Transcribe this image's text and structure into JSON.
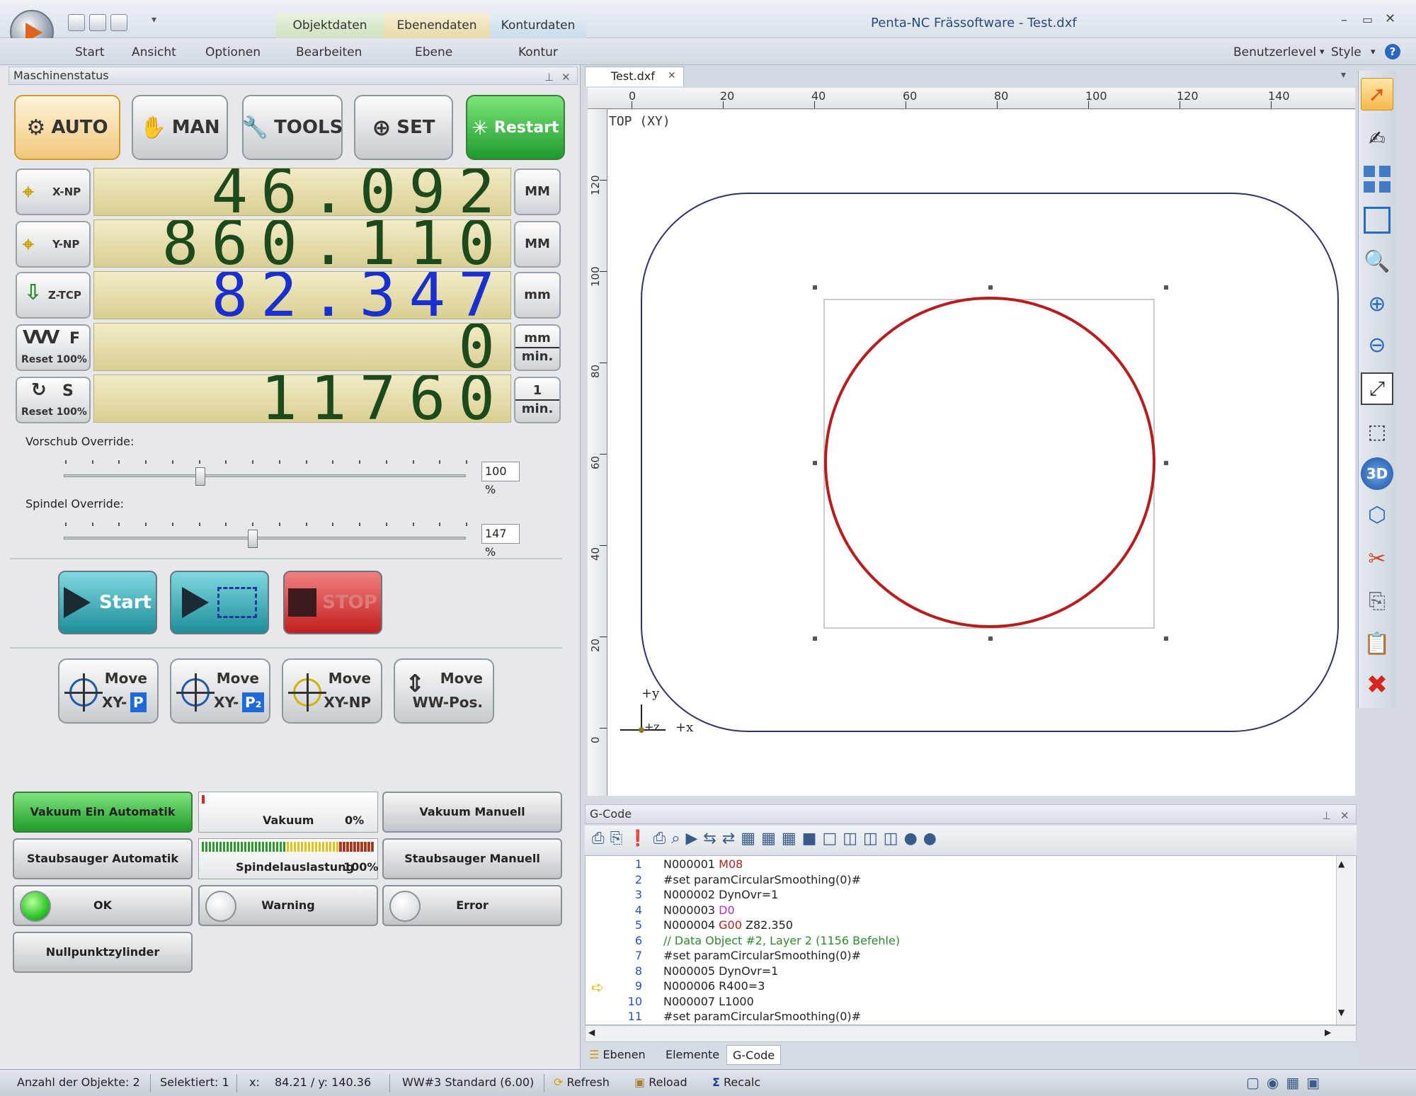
{
  "window": {
    "title": "Penta-NC Frässoftware - Test.dxf"
  },
  "ribbon": {
    "context_headers": [
      "Objektdaten",
      "Ebenendaten",
      "Konturdaten"
    ],
    "tabs": [
      "Start",
      "Ansicht",
      "Optionen",
      "Bearbeiten",
      "Ebene",
      "Kontur"
    ],
    "right": {
      "userlevel": "Benutzerlevel",
      "style": "Style"
    }
  },
  "machine_panel": {
    "title": "Maschinenstatus",
    "modes": {
      "auto": "AUTO",
      "man": "MAN",
      "tools": "TOOLS",
      "set": "SET",
      "restart": "Restart"
    },
    "dro": [
      {
        "label": "X-NP",
        "value": "46.092",
        "unit_top": "MM",
        "unit_bottom": "",
        "color": "#1d4a1d"
      },
      {
        "label": "Y-NP",
        "value": "860.110",
        "unit_top": "MM",
        "unit_bottom": "",
        "color": "#1d4a1d"
      },
      {
        "label": "Z-TCP",
        "value": "82.347",
        "unit_top": "mm",
        "unit_bottom": "",
        "color": "#1a2fd0"
      },
      {
        "label": "F",
        "sub": "Reset 100%",
        "value": "0",
        "unit_top": "mm",
        "unit_bottom": "min.",
        "color": "#1d4a1d"
      },
      {
        "label": "S",
        "sub": "Reset 100%",
        "value": "11760",
        "unit_top": "1",
        "unit_bottom": "min.",
        "color": "#1d4a1d"
      }
    ],
    "feed_override": {
      "label": "Vorschub Override:",
      "value": "100 %",
      "level": 0.34
    },
    "spindle_override": {
      "label": "Spindel Override:",
      "value": "147 %",
      "level": 0.47
    },
    "run": {
      "start": "Start",
      "stop": "STOP"
    },
    "moves": [
      {
        "top": "Move",
        "bottom": "XY-",
        "badge": "P"
      },
      {
        "top": "Move",
        "bottom": "XY-",
        "badge": "P₂"
      },
      {
        "top": "Move",
        "bottom": "XY-NP",
        "badge": ""
      },
      {
        "top": "Move",
        "bottom": "WW-Pos.",
        "badge": ""
      }
    ],
    "status": {
      "vakuum_auto": "Vakuum Ein Automatik",
      "vakuum_label": "Vakuum",
      "vakuum_pct": "0%",
      "vakuum_manuell": "Vakuum Manuell",
      "sauger_auto": "Staubsauger Automatik",
      "spindel_label": "Spindelauslastung",
      "spindel_pct": "100%",
      "sauger_manuell": "Staubsauger Manuell",
      "ok": "OK",
      "warning": "Warning",
      "error": "Error",
      "nullpunkt": "Nullpunktzylinder"
    }
  },
  "document": {
    "tab": "Test.dxf",
    "view_label": "TOP (XY)",
    "ruler_x": [
      "0",
      "20",
      "40",
      "60",
      "80",
      "100",
      "120",
      "140"
    ],
    "ruler_y": [
      "120",
      "100",
      "80",
      "60",
      "40",
      "20",
      "0"
    ],
    "axes": {
      "y": "+y",
      "x": "+x",
      "z": "+z"
    }
  },
  "gcode": {
    "title": "G-Code",
    "lines": [
      {
        "n": "1",
        "text": "N000001 ",
        "kw": "M08",
        "kwcolor": "#b22222"
      },
      {
        "n": "2",
        "text": "#set paramCircularSmoothing(0)#",
        "kw": "",
        "kwcolor": ""
      },
      {
        "n": "3",
        "text": "N000002 DynOvr=1",
        "kw": "",
        "kwcolor": ""
      },
      {
        "n": "4",
        "text": "N000003 ",
        "kw": "D0",
        "kwcolor": "#b030c0"
      },
      {
        "n": "5",
        "text": "N000004 ",
        "kw": "G00",
        "kwcolor": "#b22222",
        "rest": " Z82.350"
      },
      {
        "n": "6",
        "text": "// Data Object #2, Layer 2 (1156 Befehle)",
        "kw": "",
        "kwcolor": "",
        "comment": true
      },
      {
        "n": "7",
        "text": "#set paramCircularSmoothing(0)#",
        "kw": "",
        "kwcolor": ""
      },
      {
        "n": "8",
        "text": "N000005 DynOvr=1",
        "kw": "",
        "kwcolor": ""
      },
      {
        "n": "9",
        "text": "N000006 R400=3",
        "kw": "",
        "kwcolor": ""
      },
      {
        "n": "10",
        "text": "N000007 L1000",
        "kw": "",
        "kwcolor": ""
      },
      {
        "n": "11",
        "text": "#set paramCircularSmoothing(0)#",
        "kw": "",
        "kwcolor": ""
      }
    ],
    "bottom_tabs": [
      "Ebenen",
      "Elemente",
      "G-Code"
    ]
  },
  "statusbar": {
    "objects": "Anzahl der Objekte: 2",
    "selected": "Selektiert: 1",
    "coords_prefix": "x:",
    "coords": "84.21 / y:  140.36",
    "tool": "WW#3 Standard (6.00)",
    "refresh": "Refresh",
    "reload": "Reload",
    "recalc": "Recalc"
  }
}
